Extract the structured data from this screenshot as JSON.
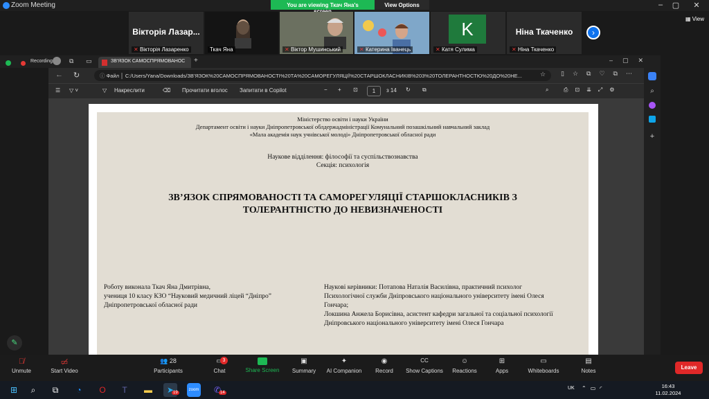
{
  "window": {
    "title": "Zoom Meeting",
    "viewing": "You are viewing Ткач Яна's screen",
    "view_options": "View Options"
  },
  "participants": [
    {
      "name": "Вікторія Лазаренко",
      "display": "Вікторія Лазар...",
      "muted": true
    },
    {
      "name": "Ткач Яна"
    },
    {
      "name": "Віктор Мушинський",
      "muted": true
    },
    {
      "name": "Катерина Іванець",
      "muted": true
    },
    {
      "name": "Катя Сулима",
      "initial": "K",
      "muted": true
    },
    {
      "name": "Ніна Ткаченко",
      "display": "Ніна Ткаченко",
      "muted": true
    }
  ],
  "view_label": "View",
  "recording_label": "Recording",
  "browser": {
    "tab_title": "ЗВ'ЯЗОК САМОСПРЯМОВАНОС",
    "url_prefix": "Файл",
    "url": "C:/Users/Yana/Downloads/ЗВ'ЯЗОК%20САМОСПРЯМОВАНОСТІ%20ТА%20САМОРЕГУЛЯЦІЇ%20СТАРШОКЛАСНИКІВ%203%20ТОЛЕРАНТНОСТЮ%20ДО%20НЕ..."
  },
  "pdf_toolbar": {
    "draw": "Накреслити",
    "read_aloud": "Прочитати вголос",
    "ask_copilot": "Запитати в Copilot",
    "page": "1",
    "of_pages": "з 14"
  },
  "document": {
    "header1": "Міністерство освіти і науки України",
    "header2": "Департамент освіти і науки Дніпропетровської облдержадміністрації Комунальний позашкільний навчальний заклад",
    "header3": "«Мала академія наук учнівської молоді» Дніпропетровської обласної ради",
    "section1": "Наукове відділення: філософії та суспільствознавства",
    "section2": "Секція: психологія",
    "title1": "ЗВ’ЯЗОК СПРЯМОВАНОСТІ ТА САМОРЕГУЛЯЦІЇ СТАРШОКЛАСНИКІВ З",
    "title2": "ТОЛЕРАНТНІСТЮ ДО НЕВИЗНАЧЕНОСТІ",
    "author1": "Роботу виконала Ткач Яна Дмитрівна,",
    "author2": "учениця 10 класу КЗО “Науковий медичний ліцей “Дніпро”",
    "author3": "Дніпропетровської обласної ради",
    "sup1": "Наукові керівники: Потапова Наталія Василівна, практичний психолог",
    "sup2": "Психологічної служби Дніпровського національного університету імені Олеся",
    "sup3": "Гончара;",
    "sup4": "Локшина Анжела Борисівна, асистент кафедри загальної та соціальної психології",
    "sup5": "Дніпровського національного університету імені Олеся Гончара"
  },
  "toolbar": {
    "unmute": "Unmute",
    "start_video": "Start Video",
    "participants": "Participants",
    "participants_count": "28",
    "chat": "Chat",
    "chat_badge": "3",
    "share_screen": "Share Screen",
    "summary": "Summary",
    "ai_companion": "AI Companion",
    "record": "Record",
    "show_captions": "Show Captions",
    "reactions": "Reactions",
    "apps": "Apps",
    "whiteboards": "Whiteboards",
    "notes": "Notes",
    "leave": "Leave"
  },
  "taskbar": {
    "lang": "UK",
    "time": "16:43",
    "date": "11.02.2024",
    "telegram_badge": "19",
    "viber_badge": "14"
  }
}
